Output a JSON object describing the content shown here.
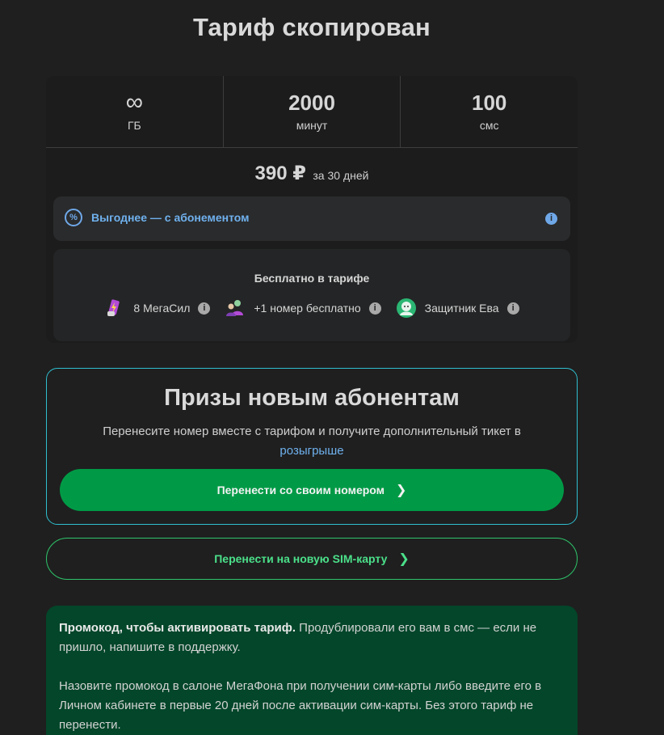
{
  "page_title": "Тариф скопирован",
  "stats": [
    {
      "value": "∞",
      "unit": "ГБ"
    },
    {
      "value": "2000",
      "unit": "минут"
    },
    {
      "value": "100",
      "unit": "смс"
    }
  ],
  "price": {
    "amount": "390 ₽",
    "period": "за 30 дней"
  },
  "promo_bar": {
    "icon": "percent-icon",
    "text": "Выгоднее — с абонементом",
    "info_icon": "info-icon"
  },
  "free_block": {
    "title": "Бесплатно в тарифе",
    "items": [
      {
        "label": "8 МегаСил",
        "icon": "megasil-icon"
      },
      {
        "label": "+1 номер бесплатно",
        "icon": "users-icon"
      },
      {
        "label": "Защитник Ева",
        "icon": "eva-avatar-icon"
      }
    ]
  },
  "prizes": {
    "title": "Призы новым абонентам",
    "desc_before": "Перенесите номер вместе с тарифом и получите дополнительный тикет в ",
    "desc_link": "розыгрыше",
    "primary_button": "Перенести со своим номером"
  },
  "secondary_button": "Перенести на новую SIM-карту",
  "info_card": {
    "bold": "Промокод, чтобы активировать тариф.",
    "p1_rest": " Продублировали его вам в смс — если не пришло, напишите в поддержку.",
    "p2": "Назовите промокод в салоне МегаФона при получении сим-карты либо введите его в Личном кабинете в первые 20 дней после активации сим-карты. Без этого тариф не перенести."
  },
  "colors": {
    "background": "#1f1f1f",
    "accent_green": "#009a46",
    "link_blue": "#6fb1ee",
    "info_card_bg": "#03462a",
    "border_cyan": "#2fbfcf"
  }
}
